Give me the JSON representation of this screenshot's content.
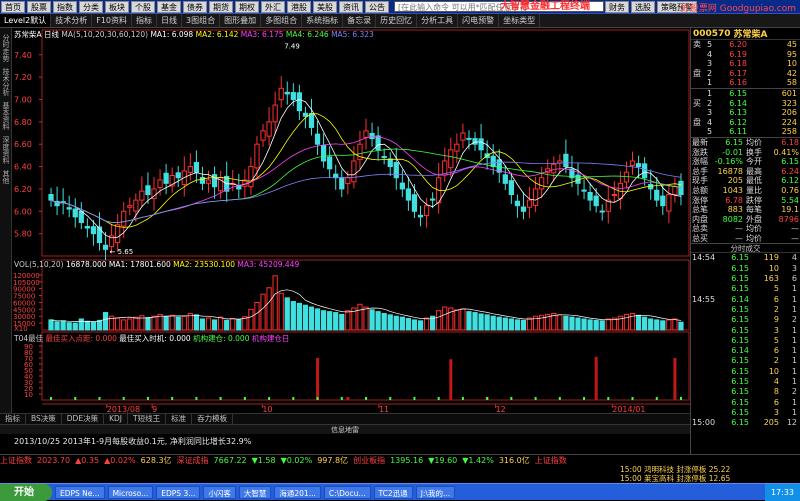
{
  "toolbar": {
    "buttons": [
      "首页",
      "股票",
      "指数",
      "分类",
      "板块",
      "个股",
      "基金",
      "债券",
      "期货",
      "期权",
      "外汇",
      "港股",
      "美股",
      "资讯",
      "公告"
    ],
    "search_placeholder": "[在此输入命令  可以用*匹配任意字符",
    "right_buttons": [
      "财务",
      "选股",
      "策略预警"
    ],
    "app_title": "大智慧金融工程终端",
    "brand": "好股票网 Goodgupiao.com"
  },
  "tabs": [
    "Level2默认",
    "技术分析",
    "F10资料",
    "指标",
    "日线",
    "3图组合",
    "图形叠加",
    "多图组合",
    "系统指标",
    "备忘录",
    "历史回忆",
    "分析工具",
    "闪电预警",
    "坐标类型"
  ],
  "left_tabs": [
    "分时走势",
    "技术分析",
    "基本资料",
    "深度资料",
    "其他"
  ],
  "price_header": {
    "name": "苏常柴A",
    "period": "日线",
    "ma_label": "MA(5,10,20,30,60,120)",
    "ma_values": [
      "MA1: 6.098",
      "MA2: 6.142",
      "MA3: 6.175",
      "MA4: 6.246",
      "MA5: 6.323"
    ],
    "ma_colors": [
      "#ffffff",
      "#ffff00",
      "#ff40ff",
      "#40ff40",
      "#8080ff",
      "#c0c0c0"
    ],
    "high_label": "7.49",
    "low_label": "5.65"
  },
  "vol_header": {
    "label": "VOL(5,10,20)",
    "vol": "16878.000",
    "ma1": "MA1: 17801.600",
    "ma2": "MA2: 23530.100",
    "ma3": "MA3: 45209.449"
  },
  "sig_header": {
    "label": "T04最佳",
    "item1": "最佳买入点距: 0.000",
    "item2": "最佳买入时机: 0.000",
    "item3": "机构建仓: 0.000",
    "item4": "机构建仓日"
  },
  "axis_dates": [
    "2013/08",
    "9",
    "10",
    "11",
    "12",
    "2014/01"
  ],
  "chart_data": {
    "type": "candlestick",
    "price_axis": {
      "ticks": [
        5.8,
        6.0,
        6.2,
        6.4,
        6.6,
        6.8,
        7.0,
        7.2,
        7.4
      ],
      "ylim": [
        5.6,
        7.55
      ]
    },
    "volume_axis": {
      "ticks": [
        15000,
        30000,
        45000,
        60000,
        75000,
        90000,
        105000,
        120000
      ],
      "unit": "X10",
      "ylim": [
        0,
        135000
      ]
    },
    "signal_axis": {
      "ticks": [
        10,
        20,
        30,
        40,
        50,
        60,
        70,
        80,
        90
      ],
      "ylim": [
        0,
        100
      ]
    },
    "closes": [
      6.1,
      6.05,
      6.08,
      6.02,
      5.95,
      5.9,
      5.85,
      5.8,
      5.72,
      5.66,
      5.78,
      5.88,
      6.0,
      6.05,
      6.1,
      6.18,
      6.15,
      6.2,
      6.28,
      6.25,
      6.32,
      6.3,
      6.36,
      6.4,
      6.35,
      6.25,
      6.28,
      6.22,
      6.3,
      6.18,
      6.25,
      6.2,
      6.28,
      6.4,
      6.6,
      6.72,
      6.8,
      6.95,
      7.1,
      7.05,
      7.0,
      6.9,
      6.85,
      6.75,
      6.6,
      6.45,
      6.38,
      6.3,
      6.2,
      6.3,
      6.45,
      6.6,
      6.72,
      6.65,
      6.55,
      6.48,
      6.4,
      6.3,
      6.2,
      6.1,
      6.0,
      5.95,
      6.05,
      6.1,
      6.3,
      6.45,
      6.55,
      6.6,
      6.7,
      6.65,
      6.6,
      6.55,
      6.48,
      6.4,
      6.35,
      6.25,
      6.15,
      6.05,
      6.0,
      6.1,
      6.2,
      6.3,
      6.38,
      6.42,
      6.45,
      6.4,
      6.3,
      6.25,
      6.18,
      6.1,
      6.05,
      6.0,
      6.1,
      6.15,
      6.25,
      6.35,
      6.45,
      6.4,
      6.3,
      6.2,
      6.1,
      6.05,
      6.15,
      6.22,
      6.15
    ],
    "volumes": [
      22000,
      18000,
      20000,
      16000,
      15000,
      24000,
      19000,
      17000,
      21000,
      38000,
      30000,
      26000,
      22000,
      24000,
      28000,
      31000,
      27000,
      30000,
      34000,
      29000,
      32000,
      28000,
      30000,
      36000,
      33000,
      24000,
      26000,
      22000,
      28000,
      21000,
      25000,
      23000,
      29000,
      45000,
      60000,
      78000,
      92000,
      118000,
      80000,
      70000,
      62000,
      58000,
      54000,
      50000,
      46000,
      42000,
      40000,
      38000,
      34000,
      42000,
      48000,
      56000,
      50000,
      44000,
      40000,
      36000,
      33000,
      30000,
      28000,
      25000,
      22000,
      20000,
      26000,
      30000,
      42000,
      50000,
      48000,
      44000,
      46000,
      40000,
      38000,
      35000,
      33000,
      30000,
      28000,
      26000,
      24000,
      22000,
      21000,
      26000,
      30000,
      32000,
      34000,
      36000,
      33000,
      30000,
      28000,
      26000,
      24000,
      22000,
      21000,
      20000,
      24000,
      26000,
      30000,
      34000,
      36000,
      32000,
      28000,
      24000,
      22000,
      20000,
      22000,
      24000,
      17000
    ],
    "signal_bars": [
      {
        "i": 44,
        "h": 70
      },
      {
        "i": 49,
        "h": 5
      },
      {
        "i": 66,
        "h": 68
      },
      {
        "i": 72,
        "h": 5
      },
      {
        "i": 90,
        "h": 72
      },
      {
        "i": 103,
        "h": 70
      }
    ]
  },
  "stock": {
    "code": "000570",
    "name": "苏常柴A"
  },
  "sell_rows": [
    {
      "label": "卖",
      "n": "5",
      "price": "6.20",
      "vol": "45",
      "color": "#ff4040"
    },
    {
      "label": "",
      "n": "4",
      "price": "6.19",
      "vol": "95",
      "color": "#ff4040"
    },
    {
      "label": "",
      "n": "3",
      "price": "6.18",
      "vol": "10",
      "color": "#ff4040"
    },
    {
      "label": "盘",
      "n": "2",
      "price": "6.17",
      "vol": "42",
      "color": "#ff4040"
    },
    {
      "label": "",
      "n": "1",
      "price": "6.16",
      "vol": "58",
      "color": "#ff4040"
    }
  ],
  "buy_rows": [
    {
      "label": "",
      "n": "1",
      "price": "6.15",
      "vol": "601",
      "color": "#40ff40"
    },
    {
      "label": "买",
      "n": "2",
      "price": "6.14",
      "vol": "323",
      "color": "#40ff40"
    },
    {
      "label": "",
      "n": "3",
      "price": "6.13",
      "vol": "206",
      "color": "#40ff40"
    },
    {
      "label": "盘",
      "n": "4",
      "price": "6.12",
      "vol": "224",
      "color": "#40ff40"
    },
    {
      "label": "",
      "n": "5",
      "price": "6.11",
      "vol": "258",
      "color": "#40ff40"
    }
  ],
  "stats": [
    {
      "k": "最新",
      "v": "6.15",
      "vc": "#40ff40",
      "k2": "均价",
      "v2": "6.18",
      "v2c": "#ff4040"
    },
    {
      "k": "涨跌",
      "v": "-0.01",
      "vc": "#40ff40",
      "k2": "换手",
      "v2": "0.41%",
      "v2c": "#ffd24a"
    },
    {
      "k": "涨幅",
      "v": "-0.16%",
      "vc": "#40ff40",
      "k2": "今开",
      "v2": "6.15",
      "v2c": "#40ff40"
    },
    {
      "k": "总手",
      "v": "16878",
      "vc": "#ffd24a",
      "k2": "最高",
      "v2": "6.24",
      "v2c": "#ff4040"
    },
    {
      "k": "现手",
      "v": "205",
      "vc": "#ffd24a",
      "k2": "最低",
      "v2": "6.12",
      "v2c": "#40ff40"
    },
    {
      "k": "总额",
      "v": "1043",
      "vc": "#ffd24a",
      "k2": "量比",
      "v2": "0.76",
      "v2c": "#ffd24a"
    },
    {
      "k": "涨停",
      "v": "6.78",
      "vc": "#ff4040",
      "k2": "跌停",
      "v2": "5.54",
      "v2c": "#40ff40"
    },
    {
      "k": "总笔",
      "v": "883",
      "vc": "#ffd24a",
      "k2": "每笔",
      "v2": "19.1",
      "v2c": "#ffd24a"
    },
    {
      "k": "内盘",
      "v": "8082",
      "vc": "#40ff40",
      "k2": "外盘",
      "v2": "8796",
      "v2c": "#ff4040"
    },
    {
      "k": "总卖",
      "v": "—",
      "vc": "#ccc",
      "k2": "均价",
      "v2": "—",
      "v2c": "#ccc"
    },
    {
      "k": "总买",
      "v": "—",
      "vc": "#ccc",
      "k2": "均价",
      "v2": "—",
      "v2c": "#ccc"
    }
  ],
  "trades_header": "分时成交",
  "trades": [
    {
      "t": "14:54",
      "p": "6.15",
      "pc": "#40ff40",
      "v": "119",
      "n": "4"
    },
    {
      "t": "",
      "p": "6.15",
      "pc": "#40ff40",
      "v": "10",
      "n": "3"
    },
    {
      "t": "",
      "p": "6.15",
      "pc": "#40ff40",
      "v": "163",
      "n": "6"
    },
    {
      "t": "",
      "p": "6.15",
      "pc": "#40ff40",
      "v": "5",
      "n": "1"
    },
    {
      "t": "14:55",
      "p": "6.14",
      "pc": "#40ff40",
      "v": "6",
      "n": "1"
    },
    {
      "t": "",
      "p": "6.15",
      "pc": "#40ff40",
      "v": "2",
      "n": "1"
    },
    {
      "t": "",
      "p": "6.15",
      "pc": "#40ff40",
      "v": "9",
      "n": "2"
    },
    {
      "t": "",
      "p": "6.15",
      "pc": "#40ff40",
      "v": "3",
      "n": "1"
    },
    {
      "t": "",
      "p": "6.15",
      "pc": "#40ff40",
      "v": "5",
      "n": "1"
    },
    {
      "t": "",
      "p": "6.14",
      "pc": "#40ff40",
      "v": "6",
      "n": "1"
    },
    {
      "t": "",
      "p": "6.15",
      "pc": "#40ff40",
      "v": "2",
      "n": "1"
    },
    {
      "t": "",
      "p": "6.15",
      "pc": "#40ff40",
      "v": "10",
      "n": "1"
    },
    {
      "t": "",
      "p": "6.15",
      "pc": "#40ff40",
      "v": "4",
      "n": "1"
    },
    {
      "t": "",
      "p": "6.15",
      "pc": "#40ff40",
      "v": "8",
      "n": "2"
    },
    {
      "t": "",
      "p": "6.15",
      "pc": "#40ff40",
      "v": "6",
      "n": "1"
    },
    {
      "t": "",
      "p": "6.15",
      "pc": "#40ff40",
      "v": "3",
      "n": "1"
    },
    {
      "t": "15:00",
      "p": "6.15",
      "pc": "#40ff40",
      "v": "205",
      "n": "12"
    }
  ],
  "bottom_tabs": [
    "指标",
    "BS决策",
    "DDE决策",
    "KDJ",
    "T短线王",
    "标准",
    "吞力模板"
  ],
  "info_label": "信息地雷",
  "news": "2013/10/25  2013年1-9月每股收益0.1元, 净利润同比增长32.9%",
  "ticker": [
    {
      "text": "上证指数",
      "c": "#ff4040"
    },
    {
      "text": "2023.70",
      "c": "#ff4040"
    },
    {
      "text": "▲0.35",
      "c": "#ff4040"
    },
    {
      "text": "▲0.02%",
      "c": "#ff4040"
    },
    {
      "text": "628.3亿",
      "c": "#ffd24a"
    },
    {
      "text": "深证成指",
      "c": "#ff4040"
    },
    {
      "text": "7667.22",
      "c": "#40ff40"
    },
    {
      "text": "▼1.58",
      "c": "#40ff40"
    },
    {
      "text": "▼0.02%",
      "c": "#40ff40"
    },
    {
      "text": "997.8亿",
      "c": "#ffd24a"
    },
    {
      "text": "创业板指",
      "c": "#ff4040"
    },
    {
      "text": "1395.16",
      "c": "#40ff40"
    },
    {
      "text": "▼19.60",
      "c": "#40ff40"
    },
    {
      "text": "▼1.42%",
      "c": "#40ff40"
    },
    {
      "text": "316.0亿",
      "c": "#ffd24a"
    },
    {
      "text": "上证指数",
      "c": "#ff4040"
    }
  ],
  "alerts": [
    "15:00 鸿明科技 封涨停板 25.22",
    "15:00 莱宝高科 封涨停板 12.65"
  ],
  "taskbar": {
    "start": "开始",
    "items": [
      "EDPS Ne...",
      "Microso...",
      "EDPS 3...",
      "小闪客",
      "大智慧",
      "海通201...",
      "C:\\Docu...",
      "TC2迅通",
      "J:\\我的..."
    ],
    "clock": "17:33"
  }
}
